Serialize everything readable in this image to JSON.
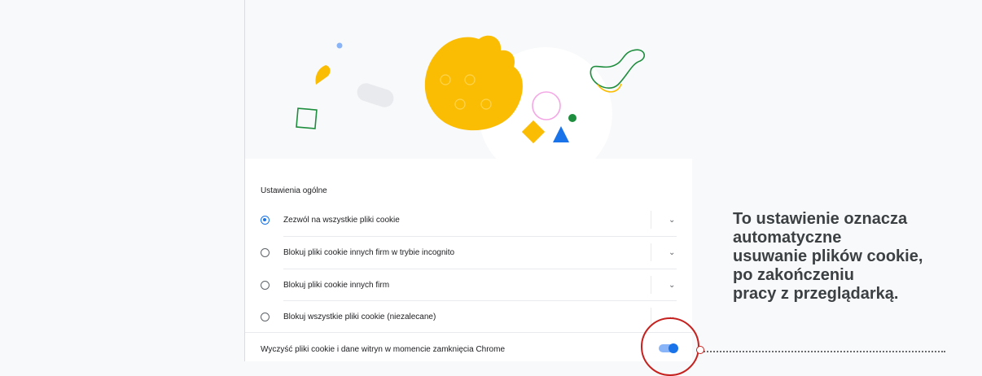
{
  "settings": {
    "section_title": "Ustawienia ogólne",
    "options": [
      {
        "label": "Zezwól na wszystkie pliki cookie",
        "selected": true
      },
      {
        "label": "Blokuj pliki cookie innych firm w trybie incognito",
        "selected": false
      },
      {
        "label": "Blokuj pliki cookie innych firm",
        "selected": false
      },
      {
        "label": "Blokuj wszystkie pliki cookie (niezalecane)",
        "selected": false
      }
    ],
    "clear_on_exit_label": "Wyczyść pliki cookie i dane witryn w momencie zamknięcia Chrome",
    "clear_on_exit_enabled": true
  },
  "callout": {
    "text_lines": [
      "To ustawienie oznacza",
      "automatyczne",
      "usuwanie plików cookie,",
      "po zakończeniu",
      "pracy z przeglądarką."
    ]
  },
  "colors": {
    "accent": "#1a73e8",
    "cookie": "#fbbc04",
    "annotation": "#c5221f"
  },
  "icons": [
    "cookie-illustration",
    "chevron-down-icon",
    "radio-icon",
    "toggle-icon"
  ]
}
